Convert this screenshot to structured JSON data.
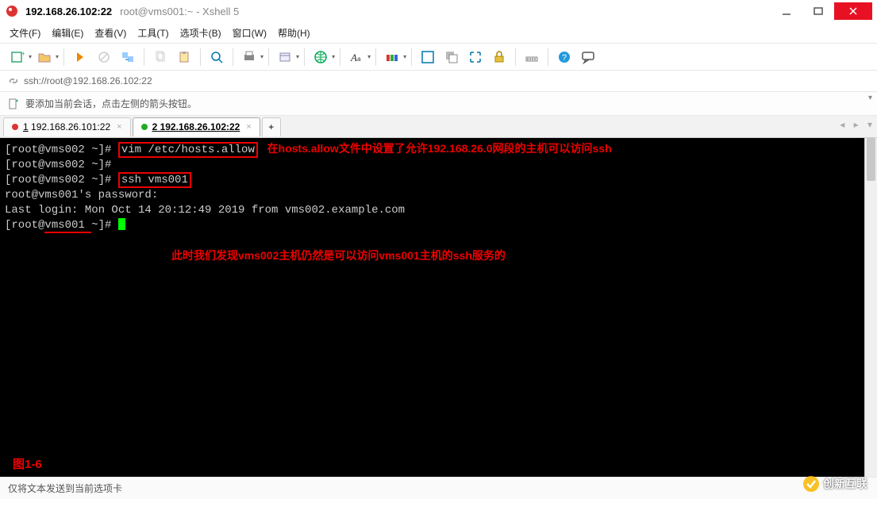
{
  "window": {
    "title_main": "192.168.26.102:22",
    "title_sub": "root@vms001:~ - Xshell 5"
  },
  "menus": {
    "file": "文件(F)",
    "edit": "编辑(E)",
    "view": "查看(V)",
    "tools": "工具(T)",
    "tabs": "选项卡(B)",
    "window": "窗口(W)",
    "help": "帮助(H)"
  },
  "address": {
    "icon_name": "link-icon",
    "url": "ssh://root@192.168.26.102:22"
  },
  "infobar": {
    "text": "要添加当前会话，点击左侧的箭头按钮。"
  },
  "tabs": {
    "items": [
      {
        "label_prefix": "1",
        "label_rest": " 192.168.26.101:22",
        "dot": "red",
        "active": false
      },
      {
        "label_prefix": "2",
        "label_rest": " 192.168.26.102:22",
        "dot": "green",
        "active": true
      }
    ],
    "add_label": "+"
  },
  "terminal": {
    "lines": [
      {
        "prompt": "[root@vms002 ~]# ",
        "boxed": "vim /etc/hosts.allow",
        "rest": "",
        "annot": "   在hosts.allow文件中设置了允许192.168.26.0网段的主机可以访问ssh"
      },
      {
        "prompt": "[root@vms002 ~]# "
      },
      {
        "prompt": "[root@vms002 ~]# ",
        "boxed": "ssh vms001"
      },
      {
        "plain": "root@vms001's password:"
      },
      {
        "plain": "Last login: Mon Oct 14 20:12:49 2019 from vms002.example.com"
      },
      {
        "prompt_pre": "[root@",
        "underlined": "vms001 ",
        "prompt_post": "~]# ",
        "cursor": true
      }
    ],
    "annot2": "此时我们发现vms002主机仍然是可以访问vms001主机的ssh服务的",
    "figure_label": "图1-6"
  },
  "statusbar": {
    "text": "仅将文本发送到当前选项卡"
  },
  "watermark": {
    "text": "创新互联"
  },
  "icons": {
    "new": "new-session-icon",
    "open": "open-folder-icon",
    "reconnect": "reconnect-icon",
    "disconnect": "disconnect-icon",
    "transfer": "transfer-icon",
    "copy": "copy-icon",
    "paste": "paste-icon",
    "search": "search-icon",
    "print": "print-icon",
    "properties": "properties-icon",
    "globe": "globe-icon",
    "colors": "colors-icon",
    "fonts": "fonts-icon",
    "fullscreen": "fullscreen-icon",
    "transparency": "transparency-icon",
    "simple": "simple-icon",
    "maximize2": "fit-icon",
    "lock": "lock-icon",
    "keys": "keys-icon",
    "help": "help-icon",
    "chat": "chat-icon"
  }
}
